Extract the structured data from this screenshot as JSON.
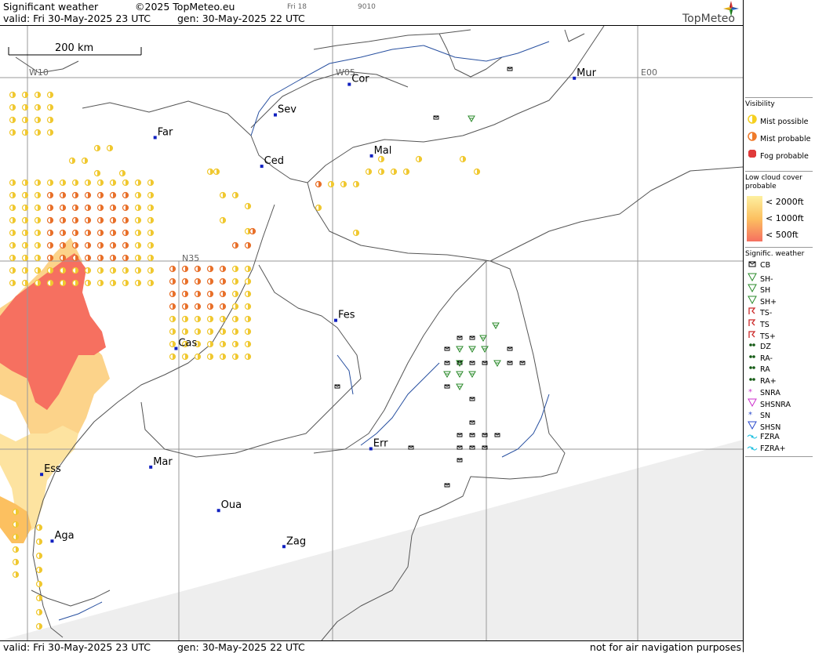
{
  "header": {
    "title": "Significant weather",
    "copyright": "©2025 TopMeteo.eu",
    "small1": "Fri 18",
    "small2": "9010",
    "valid": "valid:  Fri  30-May-2025  23 UTC",
    "gen": "gen: 30-May-2025 22 UTC",
    "brand": "TopMeteo"
  },
  "footer": {
    "valid": "valid:  Fri  30-May-2025  23 UTC",
    "gen": "gen: 30-May-2025 22 UTC",
    "disclaimer": "not for air navigation purposes"
  },
  "map": {
    "scale_label": "200 km",
    "grid_labels": [
      "W10",
      "W05",
      "E00",
      "N35"
    ],
    "cities": [
      {
        "name": "Cor",
        "lon": -4.78,
        "lat": 37.89
      },
      {
        "name": "Mur",
        "lon": -1.13,
        "lat": 37.99
      },
      {
        "name": "Sev",
        "lon": -5.98,
        "lat": 37.39
      },
      {
        "name": "Far",
        "lon": -7.93,
        "lat": 37.02
      },
      {
        "name": "Mal",
        "lon": -4.42,
        "lat": 36.72
      },
      {
        "name": "Ced",
        "lon": -6.2,
        "lat": 36.55
      },
      {
        "name": "Fes",
        "lon": -5.0,
        "lat": 34.03
      },
      {
        "name": "Cas",
        "lon": -7.59,
        "lat": 33.57
      },
      {
        "name": "Err",
        "lon": -4.43,
        "lat": 31.93
      },
      {
        "name": "Mar",
        "lon": -8.0,
        "lat": 31.63
      },
      {
        "name": "Ess",
        "lon": -9.77,
        "lat": 31.51
      },
      {
        "name": "Oua",
        "lon": -6.9,
        "lat": 30.92
      },
      {
        "name": "Aga",
        "lon": -9.6,
        "lat": 30.42
      },
      {
        "name": "Zag",
        "lon": -5.84,
        "lat": 30.33
      }
    ]
  },
  "legend": {
    "visibility_title": "Visibility",
    "visibility": [
      {
        "label": "Mist possible",
        "color": "#f5d020"
      },
      {
        "label": "Mist probable",
        "color": "#ef7a2a"
      },
      {
        "label": "Fog probable",
        "color": "#e03a3a"
      }
    ],
    "lowcloud_title": "Low cloud cover probable",
    "lowcloud": [
      {
        "label": "< 2000ft",
        "color": "#fdf0a0"
      },
      {
        "label": "< 1000ft",
        "color": "#fcc060"
      },
      {
        "label": "<   500ft",
        "color": "#f67060"
      }
    ],
    "sigwx_title": "Signific. weather",
    "sigwx": [
      {
        "label": "CB",
        "icon": "cb-icon",
        "color": "#000"
      },
      {
        "label": "SH-",
        "icon": "shower-light-icon",
        "color": "#2a8a2a"
      },
      {
        "label": "SH",
        "icon": "shower-icon",
        "color": "#2a8a2a"
      },
      {
        "label": "SH+",
        "icon": "shower-heavy-icon",
        "color": "#2a8a2a"
      },
      {
        "label": "TS-",
        "icon": "thunder-light-icon",
        "color": "#cc2a2a"
      },
      {
        "label": "TS",
        "icon": "thunder-icon",
        "color": "#cc2a2a"
      },
      {
        "label": "TS+",
        "icon": "thunder-heavy-icon",
        "color": "#cc2a2a"
      },
      {
        "label": "DZ",
        "icon": "drizzle-icon",
        "color": "#145a14"
      },
      {
        "label": "RA-",
        "icon": "rain-light-icon",
        "color": "#145a14"
      },
      {
        "label": "RA",
        "icon": "rain-icon",
        "color": "#145a14"
      },
      {
        "label": "RA+",
        "icon": "rain-heavy-icon",
        "color": "#145a14"
      },
      {
        "label": "SNRA",
        "icon": "snow-rain-icon",
        "color": "#cc30cc"
      },
      {
        "label": "SHSNRA",
        "icon": "snow-rain-shower-icon",
        "color": "#cc30cc"
      },
      {
        "label": "SN",
        "icon": "snow-icon",
        "color": "#2a4acc"
      },
      {
        "label": "SHSN",
        "icon": "snow-shower-icon",
        "color": "#2a4acc"
      },
      {
        "label": "FZRA",
        "icon": "freezing-rain-icon",
        "color": "#20c0e0"
      },
      {
        "label": "FZRA+",
        "icon": "freezing-rain-heavy-icon",
        "color": "#20c0e0"
      }
    ]
  }
}
